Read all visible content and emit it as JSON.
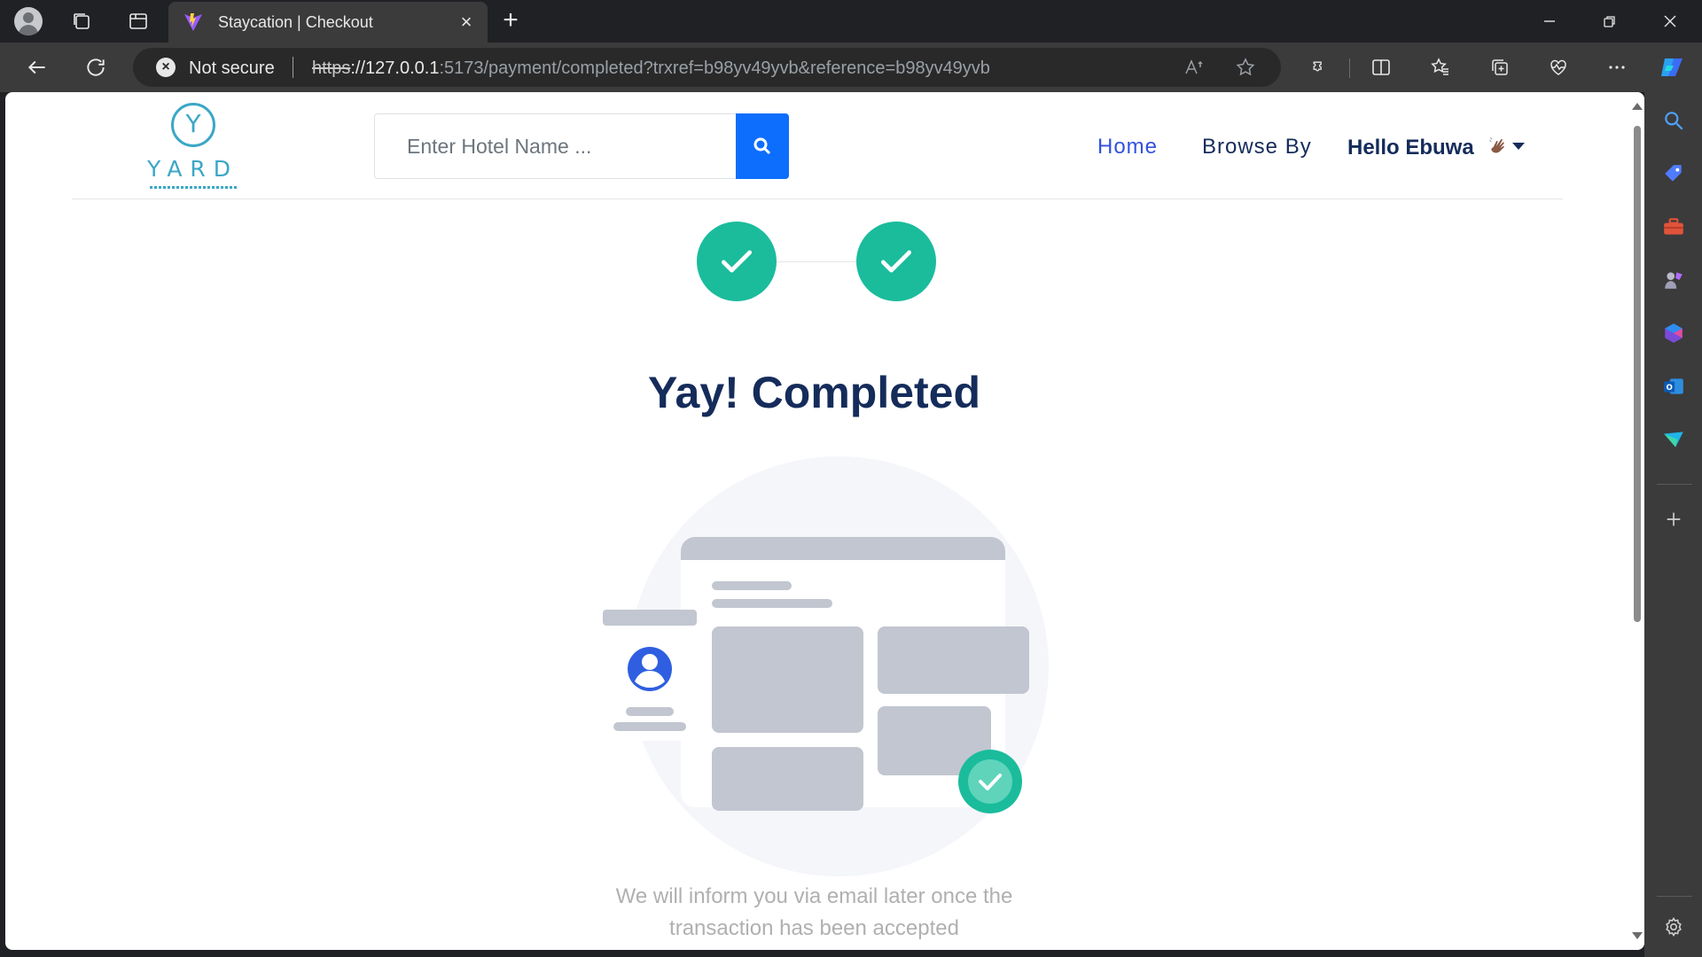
{
  "browser": {
    "tab": {
      "title": "Staycation | Checkout"
    },
    "address": {
      "security_label": "Not secure",
      "url_scheme": "https",
      "url_host": "://127.0.0.1",
      "url_rest": ":5173/payment/completed?trxref=b98yv49yvb&reference=b98yv49yvb"
    },
    "icons": {
      "profile": "profile-icon",
      "workspaces": "workspaces-icon",
      "tab_actions": "tab-actions-icon",
      "back": "back-arrow-icon",
      "refresh": "refresh-icon",
      "read_aloud": "read-aloud-icon",
      "favorite": "star-icon",
      "extensions": "extensions-icon",
      "split_screen": "split-screen-icon",
      "favorites": "favorites-icon",
      "collections": "collections-icon",
      "performance": "heart-pulse-icon",
      "more": "more-icon",
      "copilot": "copilot-icon"
    },
    "side_panel": [
      "search-icon",
      "shopping-tag-icon",
      "toolbox-icon",
      "games-icon",
      "microsoft-365-icon",
      "outlook-icon",
      "drop-icon",
      "add-icon",
      "settings-icon"
    ]
  },
  "site": {
    "logo_letter": "Y",
    "logo_word": "YARD",
    "search": {
      "placeholder": "Enter Hotel Name ..."
    },
    "nav": {
      "home": "Home",
      "browse": "Browse By",
      "user": "Hello Ebuwa"
    },
    "stepper": {
      "steps_completed": 2,
      "total_steps": 2
    },
    "title": "Yay! Completed",
    "message_line1": "We will inform you via email later once the",
    "message_line2": "transaction has been accepted"
  },
  "colors": {
    "brand_blue": "#3252df",
    "navy": "#152c5b",
    "success": "#1abc9c",
    "search_button": "#0d6efd",
    "logo": "#3ba7c6"
  }
}
